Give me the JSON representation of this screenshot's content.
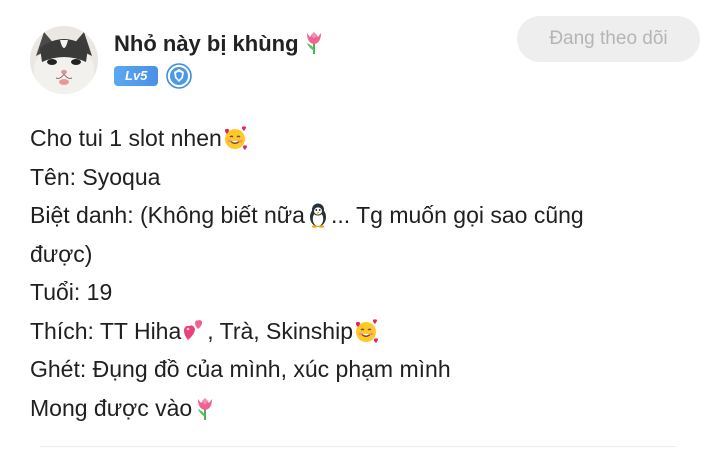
{
  "user": {
    "name": "Nhỏ này bị khùng",
    "name_emoji": "tulip-icon",
    "level": "Lv5",
    "verified_icon": "shield-badge-icon"
  },
  "follow_button": {
    "label": "Đang theo dõi"
  },
  "post": {
    "lines": [
      {
        "text": "Cho tui 1 slot nhen",
        "emoji_after": "smiling-face-with-hearts-icon"
      },
      {
        "text": "Tên: Syoqua"
      },
      {
        "text": "Biệt danh: (Không biết nữa",
        "emoji_mid": "penguin-icon",
        "text_after": "... Tg muốn gọi sao cũng"
      },
      {
        "text": "được)"
      },
      {
        "text": "Tuổi: 19"
      },
      {
        "text": "Thích: TT Hiha",
        "emoji_mid": "two-hearts-icon",
        "text_after": ", Trà, Skinship",
        "emoji_after": "smiling-face-with-hearts-icon"
      },
      {
        "text": "Ghét: Đụng đồ của mình, xúc phạm mình"
      },
      {
        "text": "Mong được vào",
        "emoji_after": "tulip-icon"
      }
    ]
  },
  "colors": {
    "level_badge": "#4a90e6",
    "follow_bg": "#eeeeee",
    "follow_text": "#b5b5b5",
    "text": "#202020"
  }
}
